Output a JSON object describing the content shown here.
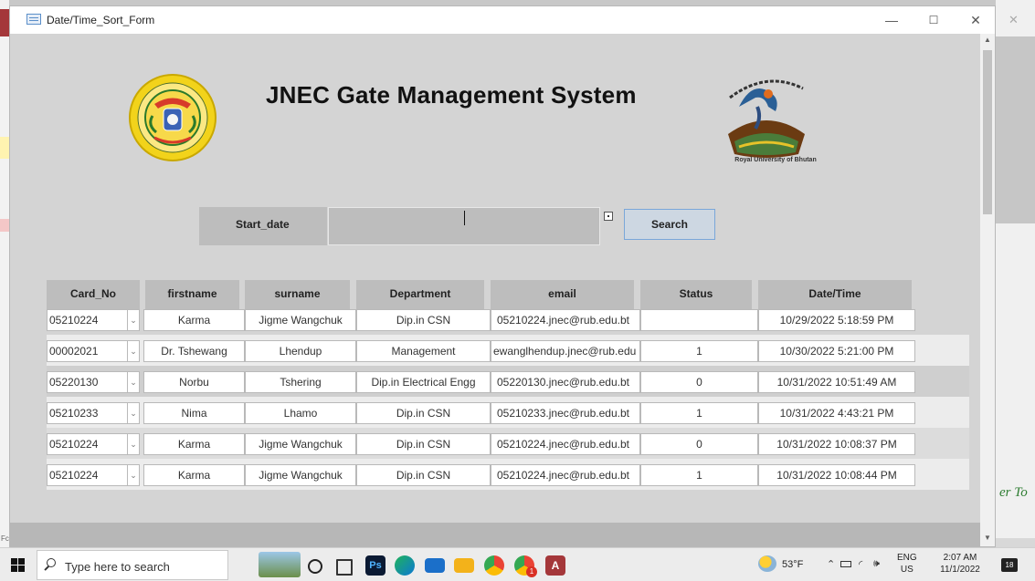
{
  "window": {
    "title": "Date/Time_Sort_Form",
    "minimize": "—",
    "maximize": "☐",
    "close": "✕"
  },
  "header": {
    "title": "JNEC Gate Management System",
    "rub_caption": "Royal University of Bhutan"
  },
  "search": {
    "label": "Start_date",
    "value": "",
    "button": "Search"
  },
  "table": {
    "columns": [
      "Card_No",
      "firstname",
      "surname",
      "Department",
      "email",
      "Status",
      "Date/Time"
    ],
    "rows": [
      {
        "card": "05210224",
        "first": "Karma",
        "sur": "Jigme Wangchuk",
        "dept": "Dip.in CSN",
        "email": "05210224.jnec@rub.edu.bt",
        "status": "",
        "dt": "10/29/2022 5:18:59 PM"
      },
      {
        "card": "00002021",
        "first": "Dr. Tshewang",
        "sur": "Lhendup",
        "dept": "Management",
        "email": "ewanglhendup.jnec@rub.edu",
        "status": "1",
        "dt": "10/30/2022 5:21:00 PM"
      },
      {
        "card": "05220130",
        "first": "Norbu",
        "sur": "Tshering",
        "dept": "Dip.in Electrical Engg",
        "email": "05220130.jnec@rub.edu.bt",
        "status": "0",
        "dt": "10/31/2022 10:51:49 AM"
      },
      {
        "card": "05210233",
        "first": "Nima",
        "sur": "Lhamo",
        "dept": "Dip.in CSN",
        "email": "05210233.jnec@rub.edu.bt",
        "status": "1",
        "dt": "10/31/2022 4:43:21 PM"
      },
      {
        "card": "05210224",
        "first": "Karma",
        "sur": "Jigme Wangchuk",
        "dept": "Dip.in CSN",
        "email": "05210224.jnec@rub.edu.bt",
        "status": "0",
        "dt": "10/31/2022 10:08:37 PM"
      },
      {
        "card": "05210224",
        "first": "Karma",
        "sur": "Jigme Wangchuk",
        "dept": "Dip.in CSN",
        "email": "05210224.jnec@rub.edu.bt",
        "status": "1",
        "dt": "10/31/2022 10:08:44 PM"
      }
    ]
  },
  "background": {
    "right_text": "er To",
    "left_text": "Fc"
  },
  "taskbar": {
    "search_placeholder": "Type here to search",
    "weather": "53°F",
    "lang_top": "ENG",
    "lang_bottom": "US",
    "time": "2:07 AM",
    "date": "11/1/2022",
    "notifications": "18",
    "badge": "1",
    "app_icons": [
      "widgets-icon",
      "cortana-icon",
      "task-view-icon",
      "photoshop-icon",
      "edge-icon",
      "mail-icon",
      "file-explorer-icon",
      "chrome-icon",
      "chrome-icon",
      "access-icon"
    ]
  },
  "colors": {
    "form_bg": "#d4d4d4",
    "header_cell": "#bdbdbd",
    "search_border": "#7aa7d9",
    "access_red": "#a4373a"
  }
}
